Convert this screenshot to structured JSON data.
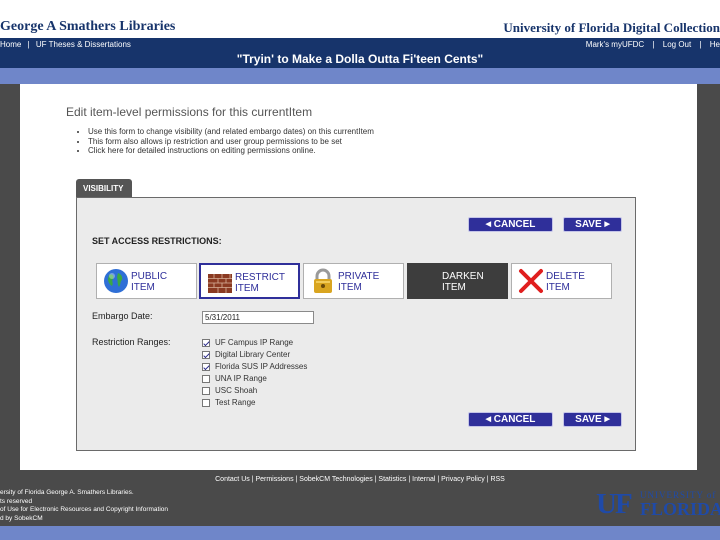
{
  "header": {
    "library_name": "George A Smathers Libraries",
    "collection_name": "University of Florida Digital Collection",
    "breadcrumbs": [
      "Home",
      "|",
      "UF Theses & Dissertations"
    ],
    "user_links": [
      "Mark's myUFDC",
      "|",
      "Log Out",
      "|",
      "He"
    ],
    "item_title": "\"Tryin' to Make a Dolla Outta Fi'teen Cents\""
  },
  "main": {
    "heading": "Edit item-level permissions for this currentItem",
    "instructions": [
      "Use this form to change visibility (and related embargo dates) on this currentItem",
      "This form also allows ip restriction and user group permissions to be set",
      "Click here for detailed instructions on editing permissions online."
    ],
    "tab_label": "VISIBILITY",
    "cancel_label": "CANCEL",
    "save_label": "SAVE",
    "access_label": "SET ACCESS RESTRICTIONS:",
    "visibility_options": [
      {
        "label": "PUBLIC\nITEM",
        "icon": "globe-icon",
        "selected": false
      },
      {
        "label": "RESTRICT\nITEM",
        "icon": "brick-wall-icon",
        "selected": false
      },
      {
        "label": "PRIVATE\nITEM",
        "icon": "padlock-icon",
        "selected": false
      },
      {
        "label": "DARKEN\nITEM",
        "icon": "none",
        "selected": true
      },
      {
        "label": "DELETE\nITEM",
        "icon": "red-x-icon",
        "selected": false
      }
    ],
    "embargo_label": "Embargo Date:",
    "embargo_value": "5/31/2011",
    "restriction_label": "Restriction Ranges:",
    "restriction_ranges": [
      {
        "label": "UF Campus IP Range",
        "checked": true
      },
      {
        "label": "Digital Library Center",
        "checked": true
      },
      {
        "label": "Florida SUS IP Addresses",
        "checked": true
      },
      {
        "label": "UNA IP Range",
        "checked": false
      },
      {
        "label": "USC Shoah",
        "checked": false
      },
      {
        "label": "Test Range",
        "checked": false
      }
    ]
  },
  "footer": {
    "links": "Contact Us | Permissions | SobekCM Technologies | Statistics | Internal | Privacy Policy | RSS",
    "copyright_lines": [
      "ersity of Florida George A. Smathers Libraries.",
      "ts reserved",
      "of Use for Electronic Resources and Copyright Information",
      "d by SobekCM"
    ],
    "logo_mark": "UF",
    "logo_university": "UNIVERSITY of",
    "logo_florida": "FLORIDA"
  },
  "colors": {
    "navy": "#17346b",
    "accent_strip": "#6f86c9",
    "button_blue": "#2f2f9a",
    "panel_bg": "#ebebeb",
    "dark_side": "#4a4a4a"
  }
}
